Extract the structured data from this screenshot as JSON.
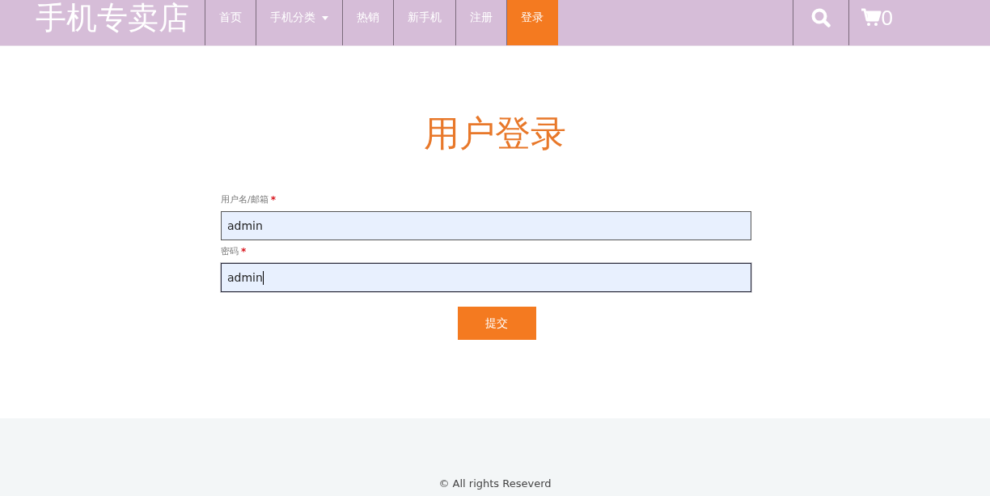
{
  "header": {
    "logo": "手机专卖店",
    "nav": [
      {
        "label": "首页",
        "selected": false,
        "dropdown": false
      },
      {
        "label": "手机分类",
        "selected": false,
        "dropdown": true
      },
      {
        "label": "热销",
        "selected": false,
        "dropdown": false
      },
      {
        "label": "新手机",
        "selected": false,
        "dropdown": false
      },
      {
        "label": "注册",
        "selected": false,
        "dropdown": false
      },
      {
        "label": "登录",
        "selected": true,
        "dropdown": false
      }
    ],
    "cart_count": "0"
  },
  "login": {
    "title": "用户登录",
    "fields": [
      {
        "label": "用户名/邮箱",
        "required_mark": "*",
        "value": "admin",
        "focused": false
      },
      {
        "label": "密码",
        "required_mark": "*",
        "value": "admin",
        "focused": true
      }
    ],
    "submit": "提交"
  },
  "footer": {
    "text": "© All rights Reseverd"
  }
}
